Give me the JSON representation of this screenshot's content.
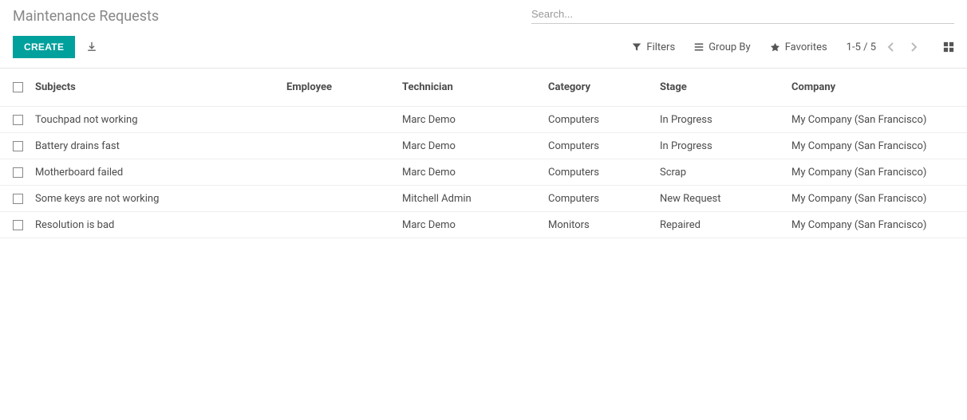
{
  "header": {
    "title": "Maintenance Requests",
    "search_placeholder": "Search..."
  },
  "toolbar": {
    "create_label": "CREATE",
    "filters_label": "Filters",
    "groupby_label": "Group By",
    "favorites_label": "Favorites",
    "pager_text": "1-5 / 5"
  },
  "columns": {
    "subjects": "Subjects",
    "employee": "Employee",
    "technician": "Technician",
    "category": "Category",
    "stage": "Stage",
    "company": "Company"
  },
  "rows": [
    {
      "subject": "Touchpad not working",
      "employee": "",
      "technician": "Marc Demo",
      "category": "Computers",
      "stage": "In Progress",
      "company": "My Company (San Francisco)"
    },
    {
      "subject": "Battery drains fast",
      "employee": "",
      "technician": "Marc Demo",
      "category": "Computers",
      "stage": "In Progress",
      "company": "My Company (San Francisco)"
    },
    {
      "subject": "Motherboard failed",
      "employee": "",
      "technician": "Marc Demo",
      "category": "Computers",
      "stage": "Scrap",
      "company": "My Company (San Francisco)"
    },
    {
      "subject": "Some keys are not working",
      "employee": "",
      "technician": "Mitchell Admin",
      "category": "Computers",
      "stage": "New Request",
      "company": "My Company (San Francisco)"
    },
    {
      "subject": "Resolution is bad",
      "employee": "",
      "technician": "Marc Demo",
      "category": "Monitors",
      "stage": "Repaired",
      "company": "My Company (San Francisco)"
    }
  ]
}
